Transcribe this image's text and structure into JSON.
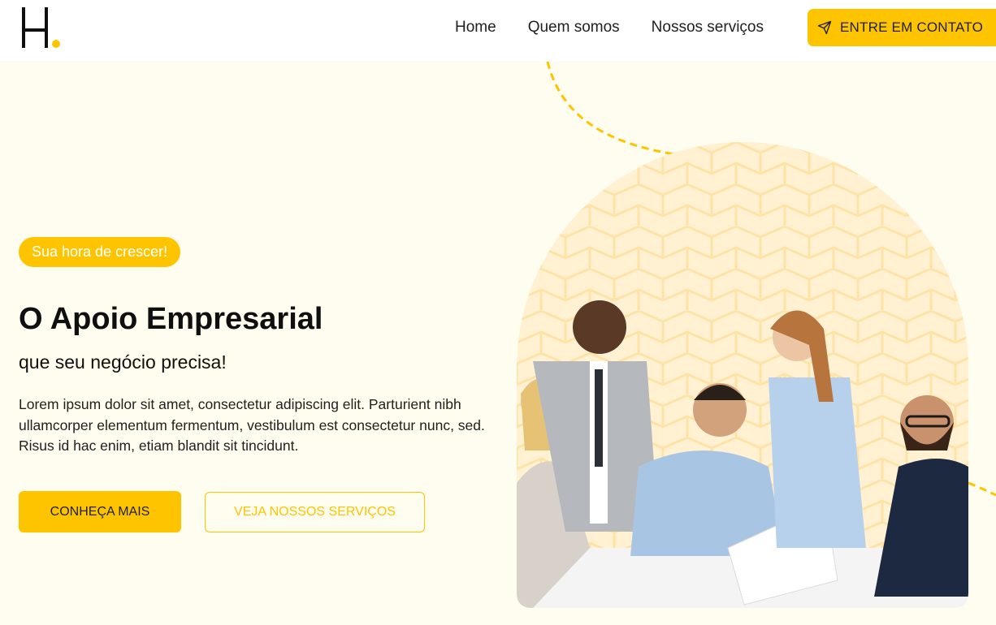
{
  "header": {
    "logo_alt": "H.",
    "nav": [
      {
        "label": "Home"
      },
      {
        "label": "Quem somos"
      },
      {
        "label": "Nossos serviços"
      }
    ],
    "cta_label": "ENTRE EM CONTATO"
  },
  "hero": {
    "badge": "Sua hora de crescer!",
    "title": "O Apoio Empresarial",
    "subtitle": "que seu negócio precisa!",
    "description": "Lorem ipsum dolor sit amet, consectetur adipiscing elit. Parturient nibh ullamcorper elementum fermentum, vestibulum est consectetur nunc, sed. Risus id hac enim, etiam blandit sit tincidunt.",
    "primary_button": "CONHEÇA MAIS",
    "secondary_button": "VEJA NOSSOS SERVIÇOS"
  },
  "colors": {
    "accent": "#ffc400",
    "background": "#fffcf0",
    "text": "#0f0f0f"
  },
  "icons": {
    "cta_icon": "send-icon"
  }
}
